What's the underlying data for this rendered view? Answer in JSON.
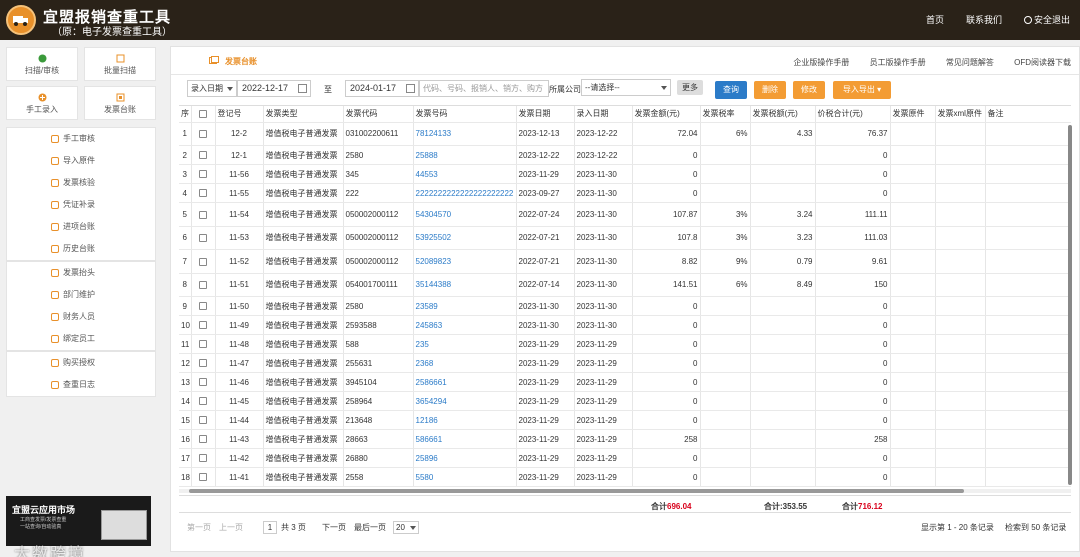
{
  "header": {
    "title": "宜盟报销查重工具",
    "subtitle": "（原：电子发票查重工具）",
    "nav": [
      "首页",
      "联系我们",
      "安全退出"
    ]
  },
  "sidebar": {
    "tiles": [
      {
        "label": "扫描/审核",
        "icon": "scan-icon"
      },
      {
        "label": "批量扫描",
        "icon": "batch-scan-icon"
      },
      {
        "label": "手工录入",
        "icon": "add-icon"
      },
      {
        "label": "发票台账",
        "icon": "ledger-icon"
      }
    ],
    "group1": [
      "手工审核",
      "导入原件",
      "发票核验",
      "凭证补录",
      "进项台账",
      "历史台账"
    ],
    "group2": [
      "发票抬头",
      "部门维护",
      "财务人员",
      "绑定员工"
    ],
    "group3": [
      "购买授权",
      "查重日志"
    ],
    "banner": {
      "title": "宜盟云应用市场",
      "line1": "工商查发票/发票查重",
      "line2": "一站查询/自动验真"
    },
    "watermark": "大数跨境"
  },
  "tab": {
    "active": "发票台账",
    "links": [
      "企业版操作手册",
      "员工版操作手册",
      "常见问题解答",
      "OFD阅读器下载"
    ]
  },
  "filters": {
    "date_type": "录入日期",
    "date_from": "2022-12-17",
    "to_label": "至",
    "date_to": "2024-01-17",
    "search_placeholder": "代码、号码、报销人、销方、购方",
    "company_label": "所属公司",
    "company_select": "--请选择--",
    "more": "更多",
    "buttons": {
      "query": "查询",
      "delete": "删除",
      "edit": "修改",
      "import_export": "导入导出"
    }
  },
  "table": {
    "columns": [
      "序",
      "",
      "登记号",
      "发票类型",
      "发票代码",
      "发票号码",
      "发票日期",
      "录入日期",
      "发票金额(元)",
      "发票税率",
      "发票税额(元)",
      "价税合计(元)",
      "发票原件",
      "发票xml原件",
      "备注"
    ],
    "rows": [
      {
        "n": "1",
        "reg": "12-2",
        "type": "增值税电子普通发票",
        "code": "031002200611",
        "num": "78124133",
        "inv_date": "2023-12-13",
        "entry_date": "2023-12-22",
        "amount": "72.04",
        "rate": "6%",
        "tax": "4.33",
        "total": "76.37"
      },
      {
        "n": "2",
        "reg": "12-1",
        "type": "增值税电子普通发票",
        "code": "2580",
        "num": "25888",
        "inv_date": "2023-12-22",
        "entry_date": "2023-12-22",
        "amount": "0",
        "rate": "",
        "tax": "",
        "total": "0"
      },
      {
        "n": "3",
        "reg": "11-56",
        "type": "增值税电子普通发票",
        "code": "345",
        "num": "44553",
        "inv_date": "2023-11-29",
        "entry_date": "2023-11-30",
        "amount": "0",
        "rate": "",
        "tax": "",
        "total": "0"
      },
      {
        "n": "4",
        "reg": "11-55",
        "type": "增值税电子普通发票",
        "code": "222",
        "num": "2222222222222222222222",
        "inv_date": "2023-09-27",
        "entry_date": "2023-11-30",
        "amount": "0",
        "rate": "",
        "tax": "",
        "total": "0"
      },
      {
        "n": "5",
        "reg": "11-54",
        "type": "增值税电子普通发票",
        "code": "050002000112",
        "num": "54304570",
        "inv_date": "2022-07-24",
        "entry_date": "2023-11-30",
        "amount": "107.87",
        "rate": "3%",
        "tax": "3.24",
        "total": "111.11"
      },
      {
        "n": "6",
        "reg": "11-53",
        "type": "增值税电子普通发票",
        "code": "050002000112",
        "num": "53925502",
        "inv_date": "2022-07-21",
        "entry_date": "2023-11-30",
        "amount": "107.8",
        "rate": "3%",
        "tax": "3.23",
        "total": "111.03"
      },
      {
        "n": "7",
        "reg": "11-52",
        "type": "增值税电子普通发票",
        "code": "050002000112",
        "num": "52089823",
        "inv_date": "2022-07-21",
        "entry_date": "2023-11-30",
        "amount": "8.82",
        "rate": "9%",
        "tax": "0.79",
        "total": "9.61"
      },
      {
        "n": "8",
        "reg": "11-51",
        "type": "增值税电子普通发票",
        "code": "054001700111",
        "num": "35144388",
        "inv_date": "2022-07-14",
        "entry_date": "2023-11-30",
        "amount": "141.51",
        "rate": "6%",
        "tax": "8.49",
        "total": "150"
      },
      {
        "n": "9",
        "reg": "11-50",
        "type": "增值税电子普通发票",
        "code": "2580",
        "num": "23589",
        "inv_date": "2023-11-30",
        "entry_date": "2023-11-30",
        "amount": "0",
        "rate": "",
        "tax": "",
        "total": "0"
      },
      {
        "n": "10",
        "reg": "11-49",
        "type": "增值税电子普通发票",
        "code": "2593588",
        "num": "245863",
        "inv_date": "2023-11-30",
        "entry_date": "2023-11-30",
        "amount": "0",
        "rate": "",
        "tax": "",
        "total": "0"
      },
      {
        "n": "11",
        "reg": "11-48",
        "type": "增值税电子普通发票",
        "code": "588",
        "num": "235",
        "inv_date": "2023-11-29",
        "entry_date": "2023-11-29",
        "amount": "0",
        "rate": "",
        "tax": "",
        "total": "0"
      },
      {
        "n": "12",
        "reg": "11-47",
        "type": "增值税电子普通发票",
        "code": "255631",
        "num": "2368",
        "inv_date": "2023-11-29",
        "entry_date": "2023-11-29",
        "amount": "0",
        "rate": "",
        "tax": "",
        "total": "0"
      },
      {
        "n": "13",
        "reg": "11-46",
        "type": "增值税电子普通发票",
        "code": "3945104",
        "num": "2586661",
        "inv_date": "2023-11-29",
        "entry_date": "2023-11-29",
        "amount": "0",
        "rate": "",
        "tax": "",
        "total": "0"
      },
      {
        "n": "14",
        "reg": "11-45",
        "type": "增值税电子普通发票",
        "code": "258964",
        "num": "3654294",
        "inv_date": "2023-11-29",
        "entry_date": "2023-11-29",
        "amount": "0",
        "rate": "",
        "tax": "",
        "total": "0"
      },
      {
        "n": "15",
        "reg": "11-44",
        "type": "增值税电子普通发票",
        "code": "213648",
        "num": "12186",
        "inv_date": "2023-11-29",
        "entry_date": "2023-11-29",
        "amount": "0",
        "rate": "",
        "tax": "",
        "total": "0"
      },
      {
        "n": "16",
        "reg": "11-43",
        "type": "增值税电子普通发票",
        "code": "28663",
        "num": "586661",
        "inv_date": "2023-11-29",
        "entry_date": "2023-11-29",
        "amount": "258",
        "rate": "",
        "tax": "",
        "total": "258"
      },
      {
        "n": "17",
        "reg": "11-42",
        "type": "增值税电子普通发票",
        "code": "26880",
        "num": "25896",
        "inv_date": "2023-11-29",
        "entry_date": "2023-11-29",
        "amount": "0",
        "rate": "",
        "tax": "",
        "total": "0"
      },
      {
        "n": "18",
        "reg": "11-41",
        "type": "增值税电子普通发票",
        "code": "2558",
        "num": "5580",
        "inv_date": "2023-11-29",
        "entry_date": "2023-11-29",
        "amount": "0",
        "rate": "",
        "tax": "",
        "total": "0"
      }
    ],
    "row_heights": "layout"
  },
  "totals": {
    "label": "合计",
    "amount": "696.04",
    "tax_text": "合计:353.55",
    "total": "716.12"
  },
  "pager": {
    "first": "第一页",
    "prev": "上一页",
    "current": "1",
    "total_pages": "共 3 页",
    "next": "下一页",
    "last": "最后一页",
    "page_size": "20",
    "showing": "显示第 1 - 20 条记录",
    "found": "检索到 50 条记录"
  }
}
